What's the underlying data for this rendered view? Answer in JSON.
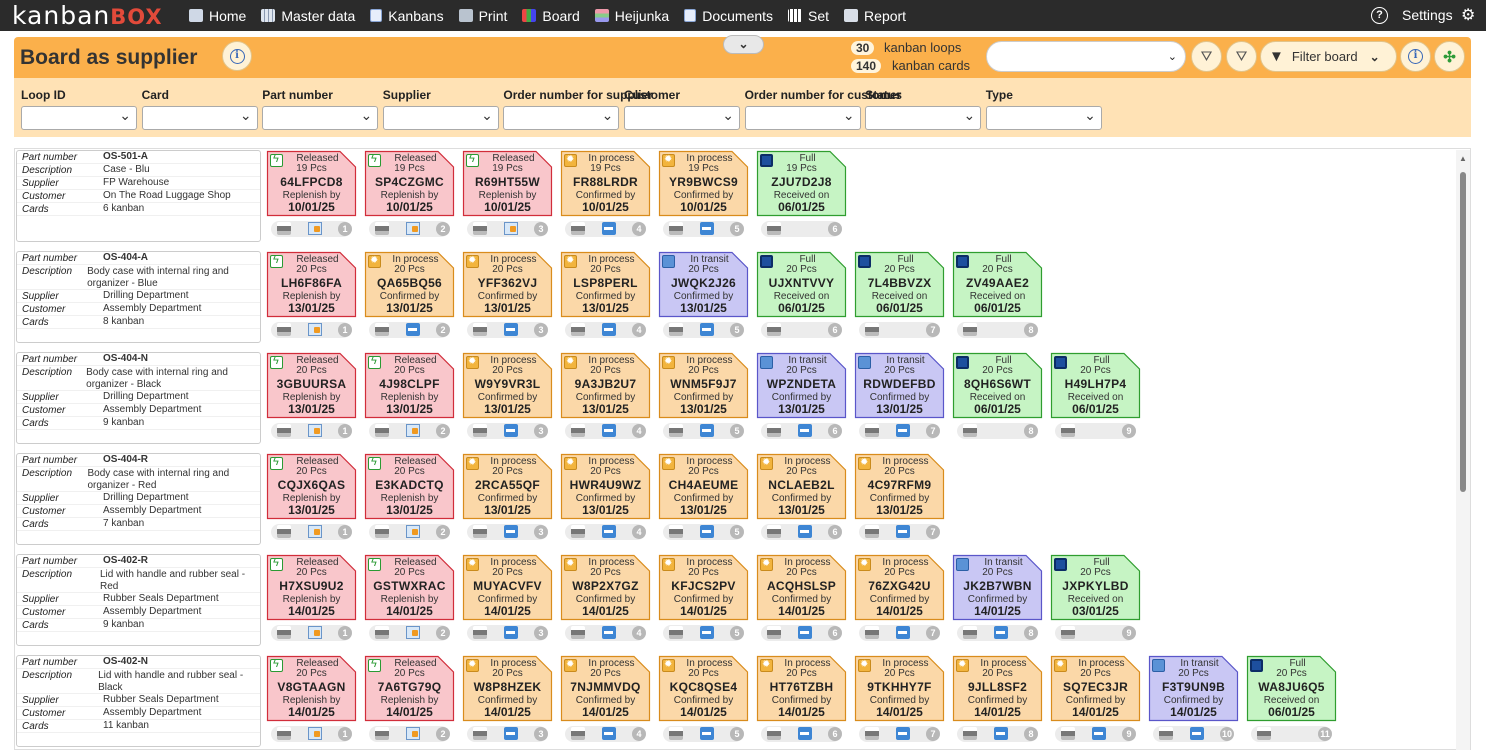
{
  "app": {
    "logo_main": "kanban",
    "logo_accent": "BOX"
  },
  "nav": [
    {
      "label": "Home",
      "icon": "home-icon"
    },
    {
      "label": "Master data",
      "icon": "master-data-icon"
    },
    {
      "label": "Kanbans",
      "icon": "kanbans-icon"
    },
    {
      "label": "Print",
      "icon": "print-icon"
    },
    {
      "label": "Board",
      "icon": "board-icon"
    },
    {
      "label": "Heijunka",
      "icon": "heijunka-icon"
    },
    {
      "label": "Documents",
      "icon": "documents-icon"
    },
    {
      "label": "Set",
      "icon": "set-icon"
    },
    {
      "label": "Report",
      "icon": "report-icon"
    }
  ],
  "top_right": {
    "help_icon": "?",
    "settings_label": "Settings",
    "gear_icon": "⚙"
  },
  "header": {
    "title": "Board as supplier",
    "info_icon": "i",
    "collapse_icon": "⌄",
    "loops_count": "30",
    "loops_label": "kanban loops",
    "cards_count": "140",
    "cards_label": "kanban cards",
    "filter_board_label": "Filter board",
    "chevron": "⌄"
  },
  "filters": [
    {
      "label": "Loop ID"
    },
    {
      "label": "Card"
    },
    {
      "label": "Part number"
    },
    {
      "label": "Supplier"
    },
    {
      "label": "Order number for supplier"
    },
    {
      "label": "Customer"
    },
    {
      "label": "Order number for customer"
    },
    {
      "label": "Status"
    },
    {
      "label": "Type"
    }
  ],
  "field_labels": {
    "part_number": "Part number",
    "description": "Description",
    "supplier": "Supplier",
    "customer": "Customer",
    "cards": "Cards"
  },
  "colors": {
    "released_bg": "#f9c6cb",
    "released_border": "#d12d3a",
    "process_bg": "#fbd8a8",
    "process_border": "#d98c1c",
    "transit_bg": "#c9c7f4",
    "transit_border": "#5a56c9",
    "full_bg": "#c6f4c4",
    "full_border": "#2f9d2f",
    "header_orange": "#fbb04b"
  },
  "rows": [
    {
      "part_number": "OS-501-A",
      "description": "Case - Blu",
      "supplier": "FP Warehouse",
      "customer": "On The Road Luggage Shop",
      "cards": "6 kanban",
      "kanbans": [
        {
          "status": "Released",
          "qty": "19 Pcs",
          "code": "64LFPCD8",
          "action": "Replenish by",
          "date": "10/01/25",
          "no": "1"
        },
        {
          "status": "Released",
          "qty": "19 Pcs",
          "code": "SP4CZGMC",
          "action": "Replenish by",
          "date": "10/01/25",
          "no": "2"
        },
        {
          "status": "Released",
          "qty": "19 Pcs",
          "code": "R69HT55W",
          "action": "Replenish by",
          "date": "10/01/25",
          "no": "3"
        },
        {
          "status": "In process",
          "qty": "19 Pcs",
          "code": "FR88LRDR",
          "action": "Confirmed by",
          "date": "10/01/25",
          "no": "4"
        },
        {
          "status": "In process",
          "qty": "19 Pcs",
          "code": "YR9BWCS9",
          "action": "Confirmed by",
          "date": "10/01/25",
          "no": "5"
        },
        {
          "status": "Full",
          "qty": "19 Pcs",
          "code": "ZJU7D2J8",
          "action": "Received on",
          "date": "06/01/25",
          "no": "6"
        }
      ]
    },
    {
      "part_number": "OS-404-A",
      "description": "Body case with internal ring and organizer - Blue",
      "supplier": "Drilling Department",
      "customer": "Assembly Department",
      "cards": "8 kanban",
      "kanbans": [
        {
          "status": "Released",
          "qty": "20 Pcs",
          "code": "LH6F86FA",
          "action": "Replenish by",
          "date": "13/01/25",
          "no": "1"
        },
        {
          "status": "In process",
          "qty": "20 Pcs",
          "code": "QA65BQ56",
          "action": "Confirmed by",
          "date": "13/01/25",
          "no": "2"
        },
        {
          "status": "In process",
          "qty": "20 Pcs",
          "code": "YFF362VJ",
          "action": "Confirmed by",
          "date": "13/01/25",
          "no": "3"
        },
        {
          "status": "In process",
          "qty": "20 Pcs",
          "code": "LSP8PERL",
          "action": "Confirmed by",
          "date": "13/01/25",
          "no": "4"
        },
        {
          "status": "In transit",
          "qty": "20 Pcs",
          "code": "JWQK2J26",
          "action": "Confirmed by",
          "date": "13/01/25",
          "no": "5"
        },
        {
          "status": "Full",
          "qty": "20 Pcs",
          "code": "UJXNTVVY",
          "action": "Received on",
          "date": "06/01/25",
          "no": "6"
        },
        {
          "status": "Full",
          "qty": "20 Pcs",
          "code": "7L4BBVZX",
          "action": "Received on",
          "date": "06/01/25",
          "no": "7"
        },
        {
          "status": "Full",
          "qty": "20 Pcs",
          "code": "ZV49AAE2",
          "action": "Received on",
          "date": "06/01/25",
          "no": "8"
        }
      ]
    },
    {
      "part_number": "OS-404-N",
      "description": "Body case with internal ring and organizer - Black",
      "supplier": "Drilling Department",
      "customer": "Assembly Department",
      "cards": "9 kanban",
      "kanbans": [
        {
          "status": "Released",
          "qty": "20 Pcs",
          "code": "3GBUURSA",
          "action": "Replenish by",
          "date": "13/01/25",
          "no": "1"
        },
        {
          "status": "Released",
          "qty": "20 Pcs",
          "code": "4J98CLPF",
          "action": "Replenish by",
          "date": "13/01/25",
          "no": "2"
        },
        {
          "status": "In process",
          "qty": "20 Pcs",
          "code": "W9Y9VR3L",
          "action": "Confirmed by",
          "date": "13/01/25",
          "no": "3"
        },
        {
          "status": "In process",
          "qty": "20 Pcs",
          "code": "9A3JB2U7",
          "action": "Confirmed by",
          "date": "13/01/25",
          "no": "4"
        },
        {
          "status": "In process",
          "qty": "20 Pcs",
          "code": "WNM5F9J7",
          "action": "Confirmed by",
          "date": "13/01/25",
          "no": "5"
        },
        {
          "status": "In transit",
          "qty": "20 Pcs",
          "code": "WPZNDETA",
          "action": "Confirmed by",
          "date": "13/01/25",
          "no": "6"
        },
        {
          "status": "In transit",
          "qty": "20 Pcs",
          "code": "RDWDEFBD",
          "action": "Confirmed by",
          "date": "13/01/25",
          "no": "7"
        },
        {
          "status": "Full",
          "qty": "20 Pcs",
          "code": "8QH6S6WT",
          "action": "Received on",
          "date": "06/01/25",
          "no": "8"
        },
        {
          "status": "Full",
          "qty": "20 Pcs",
          "code": "H49LH7P4",
          "action": "Received on",
          "date": "06/01/25",
          "no": "9"
        }
      ]
    },
    {
      "part_number": "OS-404-R",
      "description": "Body case with internal ring and organizer - Red",
      "supplier": "Drilling Department",
      "customer": "Assembly Department",
      "cards": "7 kanban",
      "kanbans": [
        {
          "status": "Released",
          "qty": "20 Pcs",
          "code": "CQJX6QAS",
          "action": "Replenish by",
          "date": "13/01/25",
          "no": "1"
        },
        {
          "status": "Released",
          "qty": "20 Pcs",
          "code": "E3KADCTQ",
          "action": "Replenish by",
          "date": "13/01/25",
          "no": "2"
        },
        {
          "status": "In process",
          "qty": "20 Pcs",
          "code": "2RCA55QF",
          "action": "Confirmed by",
          "date": "13/01/25",
          "no": "3"
        },
        {
          "status": "In process",
          "qty": "20 Pcs",
          "code": "HWR4U9WZ",
          "action": "Confirmed by",
          "date": "13/01/25",
          "no": "4"
        },
        {
          "status": "In process",
          "qty": "20 Pcs",
          "code": "CH4AEUME",
          "action": "Confirmed by",
          "date": "13/01/25",
          "no": "5"
        },
        {
          "status": "In process",
          "qty": "20 Pcs",
          "code": "NCLAEB2L",
          "action": "Confirmed by",
          "date": "13/01/25",
          "no": "6"
        },
        {
          "status": "In process",
          "qty": "20 Pcs",
          "code": "4C97RFM9",
          "action": "Confirmed by",
          "date": "13/01/25",
          "no": "7"
        }
      ]
    },
    {
      "part_number": "OS-402-R",
      "description": "Lid with handle and rubber seal - Red",
      "supplier": "Rubber Seals Department",
      "customer": "Assembly Department",
      "cards": "9 kanban",
      "kanbans": [
        {
          "status": "Released",
          "qty": "20 Pcs",
          "code": "H7XSU9U2",
          "action": "Replenish by",
          "date": "14/01/25",
          "no": "1"
        },
        {
          "status": "Released",
          "qty": "20 Pcs",
          "code": "GSTWXRAC",
          "action": "Replenish by",
          "date": "14/01/25",
          "no": "2"
        },
        {
          "status": "In process",
          "qty": "20 Pcs",
          "code": "MUYACVFV",
          "action": "Confirmed by",
          "date": "14/01/25",
          "no": "3"
        },
        {
          "status": "In process",
          "qty": "20 Pcs",
          "code": "W8P2X7GZ",
          "action": "Confirmed by",
          "date": "14/01/25",
          "no": "4"
        },
        {
          "status": "In process",
          "qty": "20 Pcs",
          "code": "KFJCS2PV",
          "action": "Confirmed by",
          "date": "14/01/25",
          "no": "5"
        },
        {
          "status": "In process",
          "qty": "20 Pcs",
          "code": "ACQHSLSP",
          "action": "Confirmed by",
          "date": "14/01/25",
          "no": "6"
        },
        {
          "status": "In process",
          "qty": "20 Pcs",
          "code": "76ZXG42U",
          "action": "Confirmed by",
          "date": "14/01/25",
          "no": "7"
        },
        {
          "status": "In transit",
          "qty": "20 Pcs",
          "code": "JK2B7WBN",
          "action": "Confirmed by",
          "date": "14/01/25",
          "no": "8"
        },
        {
          "status": "Full",
          "qty": "20 Pcs",
          "code": "JXPKYLBD",
          "action": "Received on",
          "date": "03/01/25",
          "no": "9"
        }
      ]
    },
    {
      "part_number": "OS-402-N",
      "description": "Lid with handle and rubber seal - Black",
      "supplier": "Rubber Seals Department",
      "customer": "Assembly Department",
      "cards": "11 kanban",
      "kanbans": [
        {
          "status": "Released",
          "qty": "20 Pcs",
          "code": "V8GTAAGN",
          "action": "Replenish by",
          "date": "14/01/25",
          "no": "1"
        },
        {
          "status": "Released",
          "qty": "20 Pcs",
          "code": "7A6TG79Q",
          "action": "Replenish by",
          "date": "14/01/25",
          "no": "2"
        },
        {
          "status": "In process",
          "qty": "20 Pcs",
          "code": "W8P8HZEK",
          "action": "Confirmed by",
          "date": "14/01/25",
          "no": "3"
        },
        {
          "status": "In process",
          "qty": "20 Pcs",
          "code": "7NJMMVDQ",
          "action": "Confirmed by",
          "date": "14/01/25",
          "no": "4"
        },
        {
          "status": "In process",
          "qty": "20 Pcs",
          "code": "KQC8QSE4",
          "action": "Confirmed by",
          "date": "14/01/25",
          "no": "5"
        },
        {
          "status": "In process",
          "qty": "20 Pcs",
          "code": "HT76TZBH",
          "action": "Confirmed by",
          "date": "14/01/25",
          "no": "6"
        },
        {
          "status": "In process",
          "qty": "20 Pcs",
          "code": "9TKHHY7F",
          "action": "Confirmed by",
          "date": "14/01/25",
          "no": "7"
        },
        {
          "status": "In process",
          "qty": "20 Pcs",
          "code": "9JLL8SF2",
          "action": "Confirmed by",
          "date": "14/01/25",
          "no": "8"
        },
        {
          "status": "In process",
          "qty": "20 Pcs",
          "code": "SQ7EC3JR",
          "action": "Confirmed by",
          "date": "14/01/25",
          "no": "9"
        },
        {
          "status": "In transit",
          "qty": "20 Pcs",
          "code": "F3T9UN9B",
          "action": "Confirmed by",
          "date": "14/01/25",
          "no": "10"
        },
        {
          "status": "Full",
          "qty": "20 Pcs",
          "code": "WA8JU6Q5",
          "action": "Received on",
          "date": "06/01/25",
          "no": "11"
        }
      ]
    }
  ]
}
